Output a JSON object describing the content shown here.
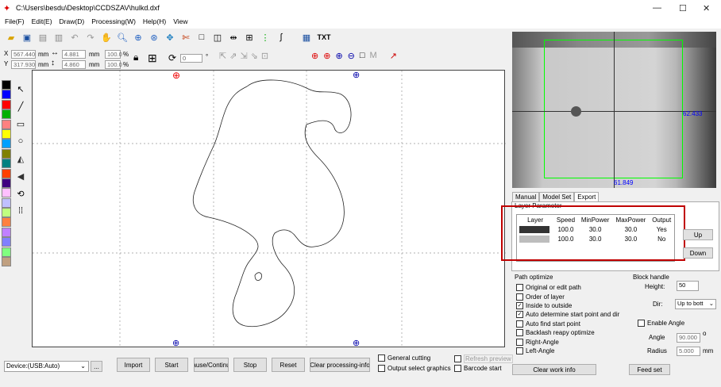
{
  "window": {
    "title": "C:\\Users\\besdu\\Desktop\\CCDSZAV\\hulkd.dxf",
    "minimize": "—",
    "maximize": "☐",
    "close": "✕"
  },
  "menu": [
    "File(F)",
    "Edit(E)",
    "Draw(D)",
    "Processing(W)",
    "Help(H)",
    "View"
  ],
  "toolbar": {
    "txt_label": "TXT"
  },
  "coords": {
    "x_label": "X",
    "y_label": "Y",
    "x_value": "567.440",
    "y_value": "317.930",
    "unit1": "mm",
    "unit2": "mm",
    "w_value": "4.881",
    "h_value": "4.860",
    "unit3": "mm",
    "unit4": "mm",
    "pct1": "100.0",
    "pct2": "100.0",
    "pct_sign1": "%",
    "pct_sign2": "%",
    "rotate_value": "0",
    "degree": "°"
  },
  "camera": {
    "label_right": "62.433",
    "label_bottom": "61.849"
  },
  "tabs": [
    "Manual",
    "Model Set",
    "Export"
  ],
  "layer": {
    "group_title": "Layer Parameter",
    "headers": [
      "Layer",
      "Speed",
      "MinPower",
      "MaxPower",
      "Output"
    ],
    "rows": [
      {
        "color": "#333333",
        "speed": "100.0",
        "min": "30.0",
        "max": "30.0",
        "output": "Yes"
      },
      {
        "color": "#bdbdbd",
        "speed": "100.0",
        "min": "30.0",
        "max": "30.0",
        "output": "No"
      }
    ],
    "up": "Up",
    "down": "Down"
  },
  "path_optimize": {
    "title": "Path optimize",
    "items": [
      {
        "label": "Original or edit path",
        "checked": false
      },
      {
        "label": "Order of layer",
        "checked": false
      },
      {
        "label": "Inside to outside",
        "checked": true
      },
      {
        "label": "Auto determine start point and dir",
        "checked": true
      },
      {
        "label": "Auto find start point",
        "checked": false
      },
      {
        "label": "Backlash reapy optimize",
        "checked": false
      },
      {
        "label": "Right-Angle",
        "checked": false
      },
      {
        "label": "Left-Angle",
        "checked": false
      }
    ]
  },
  "block": {
    "title": "Block handle",
    "height_label": "Height:",
    "height_value": "50",
    "dir_label": "Dir:",
    "dir_value": "Up to bott",
    "enable_angle": "Enable Angle",
    "angle_label": "Angle",
    "angle_value": "90.000",
    "angle_unit": "o",
    "radius_label": "Radius",
    "radius_value": "5.000",
    "radius_unit": "mm"
  },
  "bottom": {
    "device": "Device:(USB:Auto)",
    "more": "...",
    "import": "Import",
    "start": "Start",
    "pause": "ause/Continu",
    "stop": "Stop",
    "reset": "Reset",
    "clear_info": "Clear processing-info",
    "general_cutting": "General cutting",
    "output_select": "Output select graphics",
    "refresh_preview": "Refresh preview",
    "barcode_start": "Barcode start",
    "clear_work_info": "Clear work info",
    "feed_set": "Feed set"
  },
  "palette": [
    "#000000",
    "#0000ff",
    "#ff0000",
    "#00b000",
    "#ff8080",
    "#ffff00",
    "#00a0ff",
    "#808000",
    "#008080",
    "#ff4000",
    "#400080",
    "#ffc0ff",
    "#c0c0ff",
    "#c0ff80",
    "#ff8040",
    "#c080ff",
    "#8080ff",
    "#80ff80",
    "#c0a080"
  ]
}
